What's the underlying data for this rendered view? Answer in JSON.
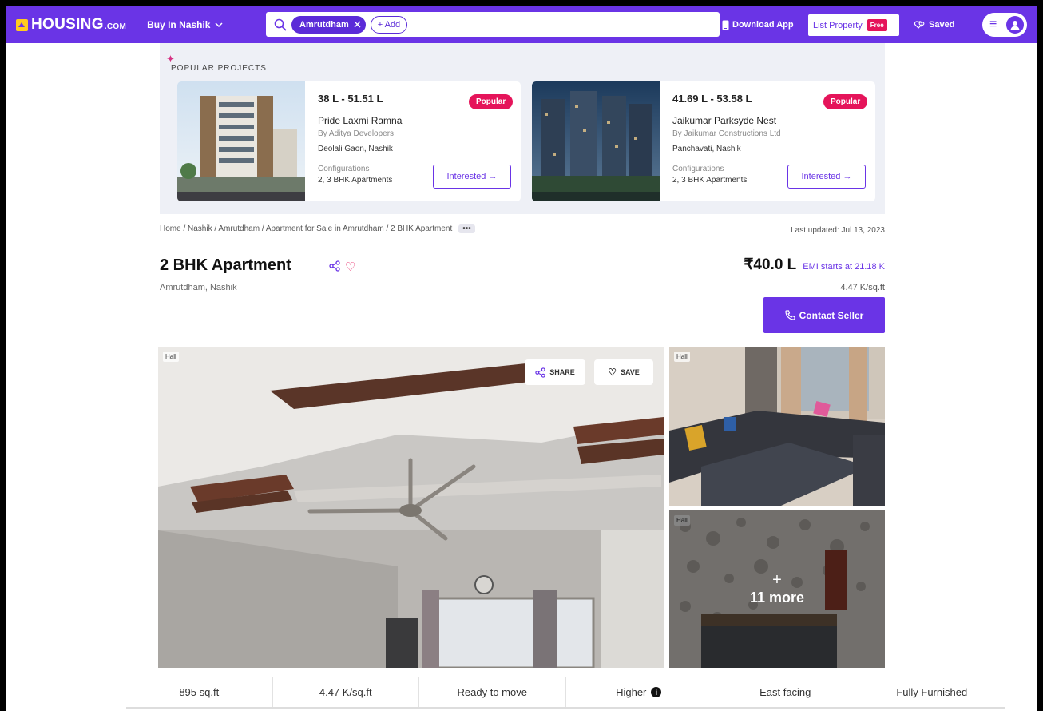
{
  "header": {
    "logo_main": "HOUSING",
    "logo_suffix": ".COM",
    "city_label": "Buy In Nashik",
    "search_chip": "Amrutdham",
    "add_chip": "+ Add",
    "download_label": "Download App",
    "list_property_label": "List Property",
    "free_badge": "Free",
    "saved_label": "Saved"
  },
  "popular": {
    "title": "POPULAR PROJECTS",
    "projects": [
      {
        "price": "38 L - 51.51 L",
        "badge": "Popular",
        "name": "Pride Laxmi Ramna",
        "developer": "By Aditya Developers",
        "location": "Deolali Gaon, Nashik",
        "config_label": "Configurations",
        "config": "2, 3 BHK Apartments",
        "button": "Interested →"
      },
      {
        "price": "41.69 L - 53.58 L",
        "badge": "Popular",
        "name": "Jaikumar Parksyde Nest",
        "developer": "By Jaikumar Constructions Ltd",
        "location": "Panchavati, Nashik",
        "config_label": "Configurations",
        "config": "2, 3 BHK Apartments",
        "button": "Interested →"
      }
    ]
  },
  "breadcrumb": {
    "path": "Home / Nashik / Amrutdham / Apartment for Sale in Amrutdham / 2 BHK Apartment",
    "more": "•••"
  },
  "last_updated": "Last updated: Jul 13, 2023",
  "property": {
    "title": "2 BHK Apartment",
    "location": "Amrutdham, Nashik",
    "price": "₹40.0 L",
    "emi": "EMI starts at  21.18 K",
    "per_sqft": "4.47 K/sq.ft",
    "contact_button": "Contact Seller"
  },
  "gallery": {
    "main_tag": "Hall",
    "side1_tag": "Hall",
    "side2_tag": "Hall",
    "share_label": "SHARE",
    "save_label": "SAVE",
    "more_plus": "+",
    "more_label": "11 more"
  },
  "stats": [
    "895 sq.ft",
    "4.47 K/sq.ft",
    "Ready to move",
    "Higher",
    "East facing",
    "Fully Furnished"
  ],
  "colors": {
    "brand": "#6a34e6",
    "badge": "#e5145a",
    "logo_accent": "#ffcc1f"
  }
}
